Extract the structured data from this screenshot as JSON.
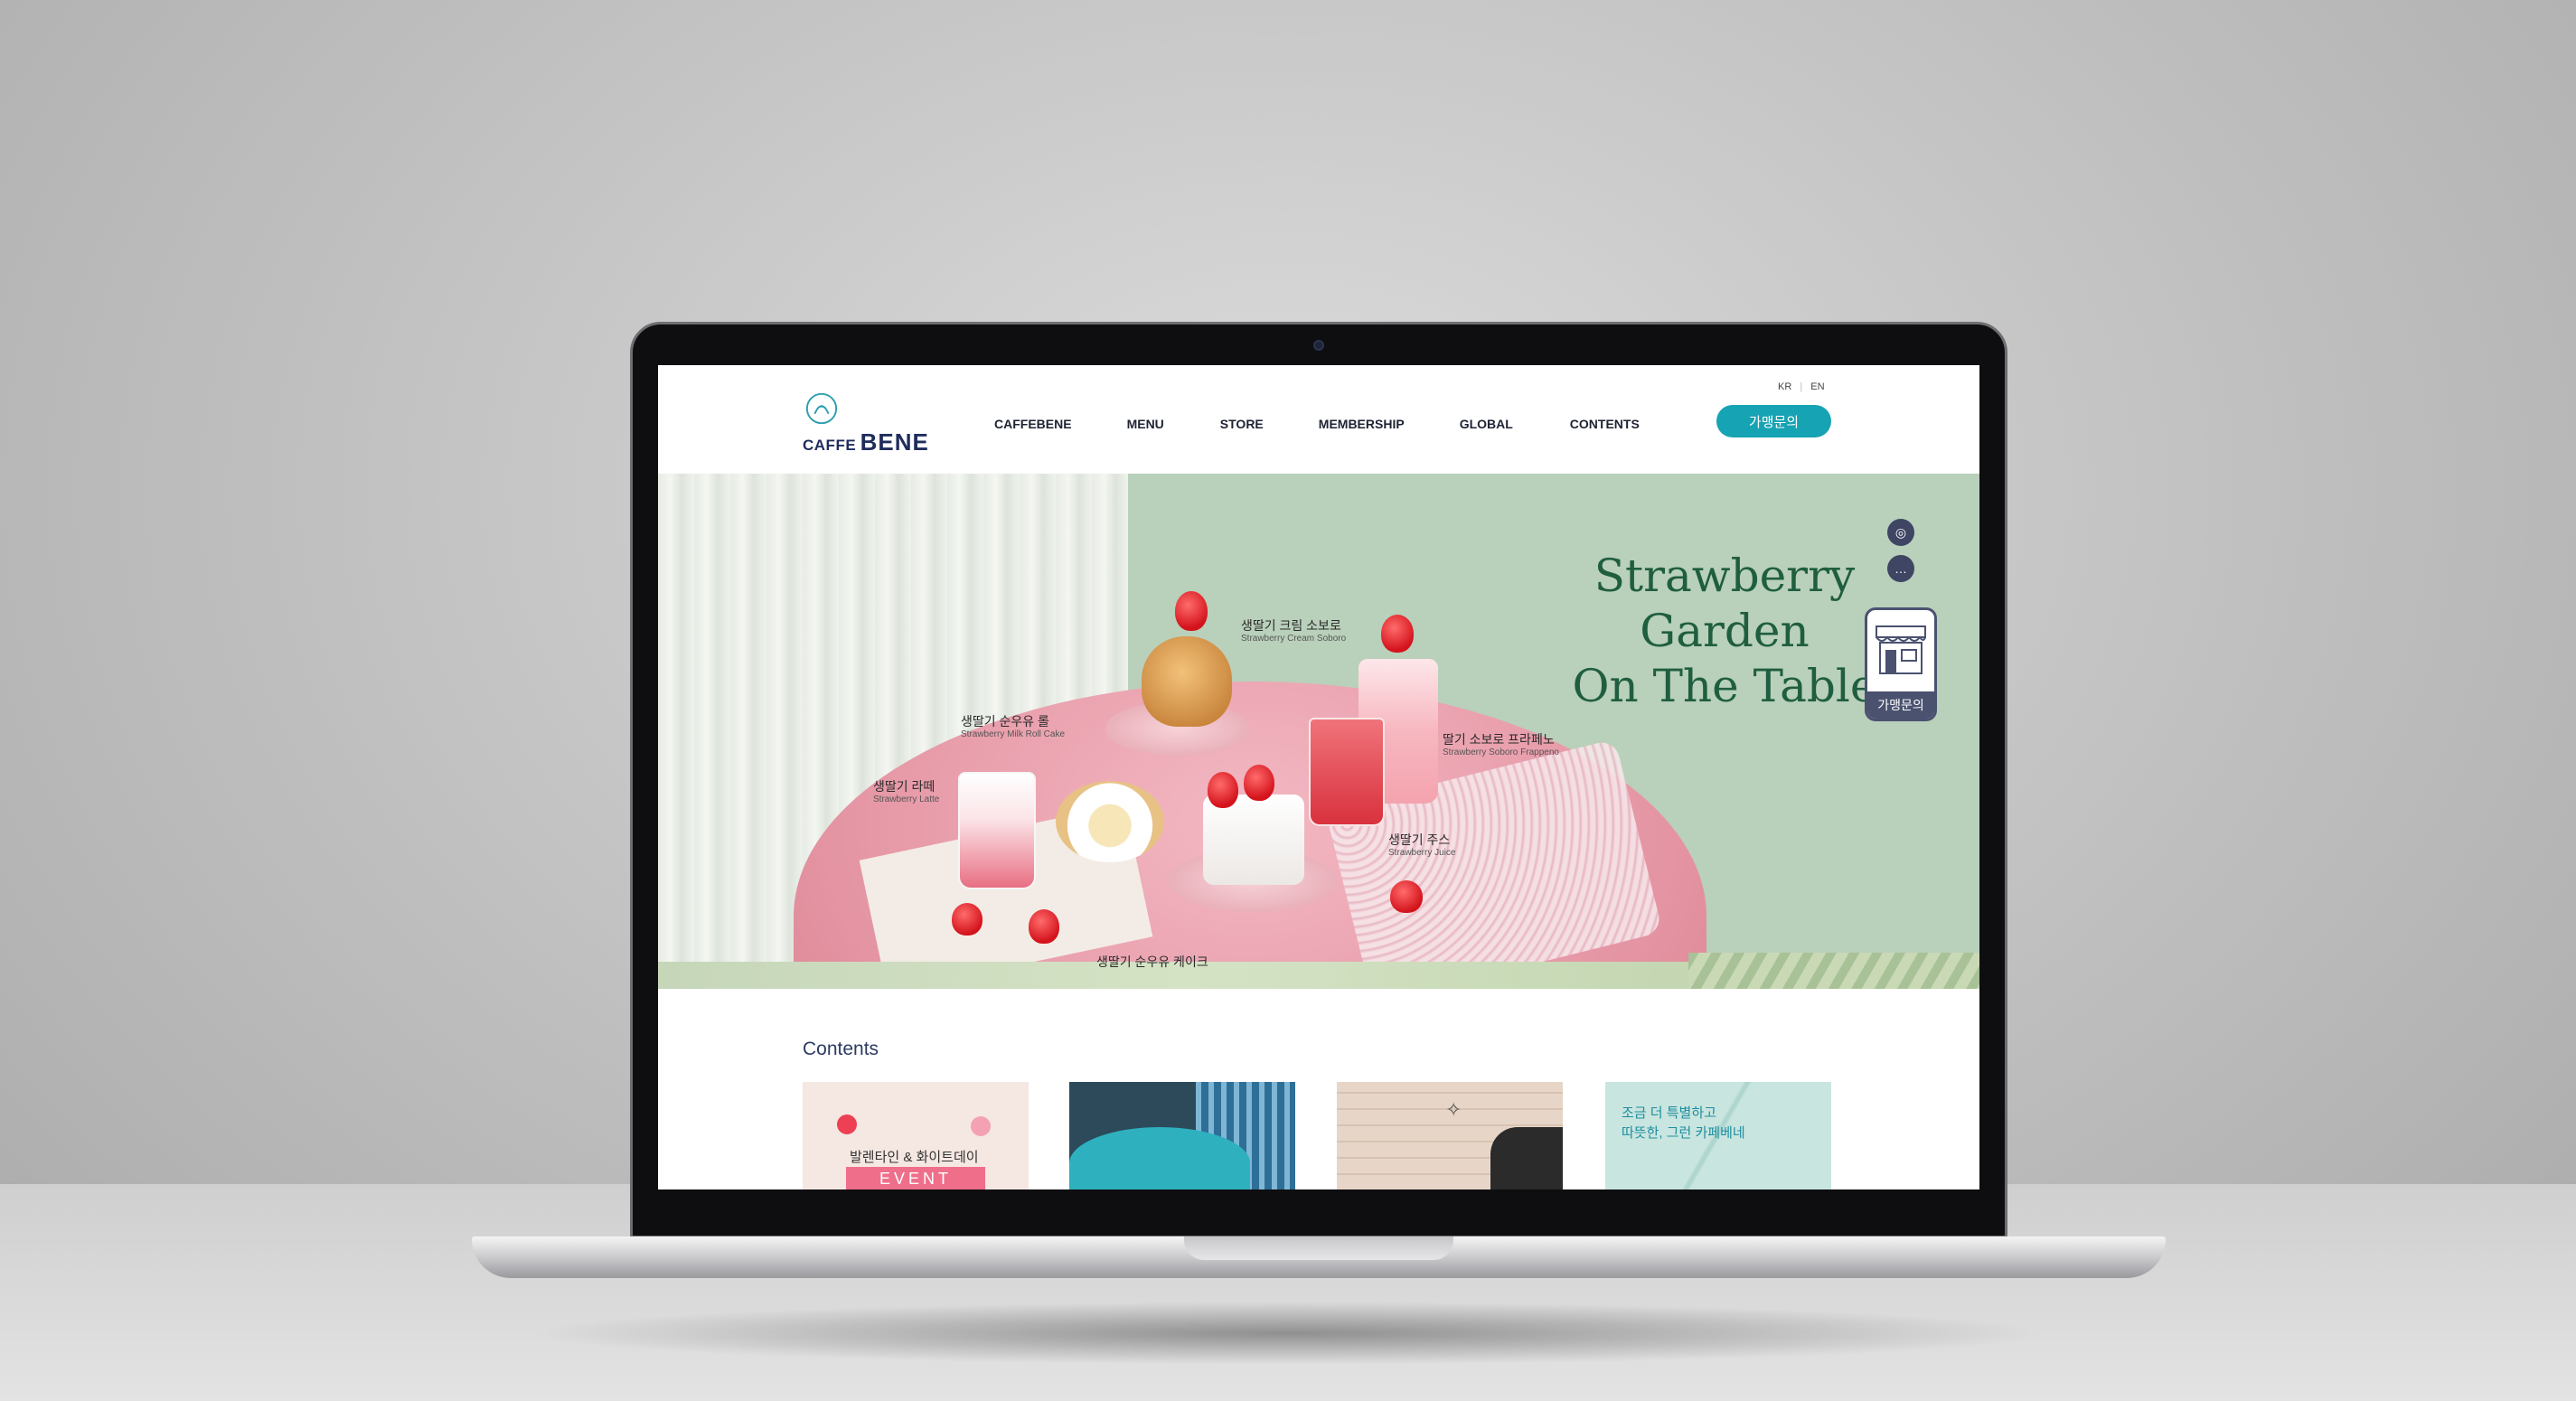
{
  "header": {
    "logo": {
      "prefix": "CAFFE",
      "name": "BENE"
    },
    "languages": [
      "KR",
      "EN"
    ],
    "nav": [
      "CAFFEBENE",
      "MENU",
      "STORE",
      "MEMBERSHIP",
      "GLOBAL",
      "CONTENTS"
    ],
    "cta_label": "가맹문의"
  },
  "hero": {
    "headline_lines": [
      "Strawberry",
      "Garden",
      "On The Table"
    ],
    "products": [
      {
        "ko": "생딸기 크림 소보로",
        "en": "Strawberry Cream Soboro"
      },
      {
        "ko": "생딸기 순우유 롤",
        "en": "Strawberry Milk Roll Cake"
      },
      {
        "ko": "생딸기 라떼",
        "en": "Strawberry Latte"
      },
      {
        "ko": "딸기 소보로 프라페노",
        "en": "Strawberry Soboro Frappeno"
      },
      {
        "ko": "생딸기 주스",
        "en": "Strawberry Juice"
      },
      {
        "ko": "생딸기 순우유 케이크",
        "en": ""
      }
    ],
    "social": [
      {
        "name": "instagram",
        "glyph": "◎"
      },
      {
        "name": "kakao",
        "glyph": "…"
      }
    ],
    "franchise_label": "가맹문의"
  },
  "contents": {
    "title": "Contents",
    "cards": [
      {
        "text": "발렌타인 & 화이트데이",
        "badge": "EVENT"
      },
      {
        "text": ""
      },
      {
        "text": ""
      },
      {
        "text": "조금 더 특별하고\n따뜻한, 그런 카페베네"
      }
    ]
  },
  "colors": {
    "brand_navy": "#1f2d5c",
    "accent_teal": "#16a3b3",
    "hero_green": "#b9d0bb",
    "headline_green": "#1f5e3f"
  }
}
